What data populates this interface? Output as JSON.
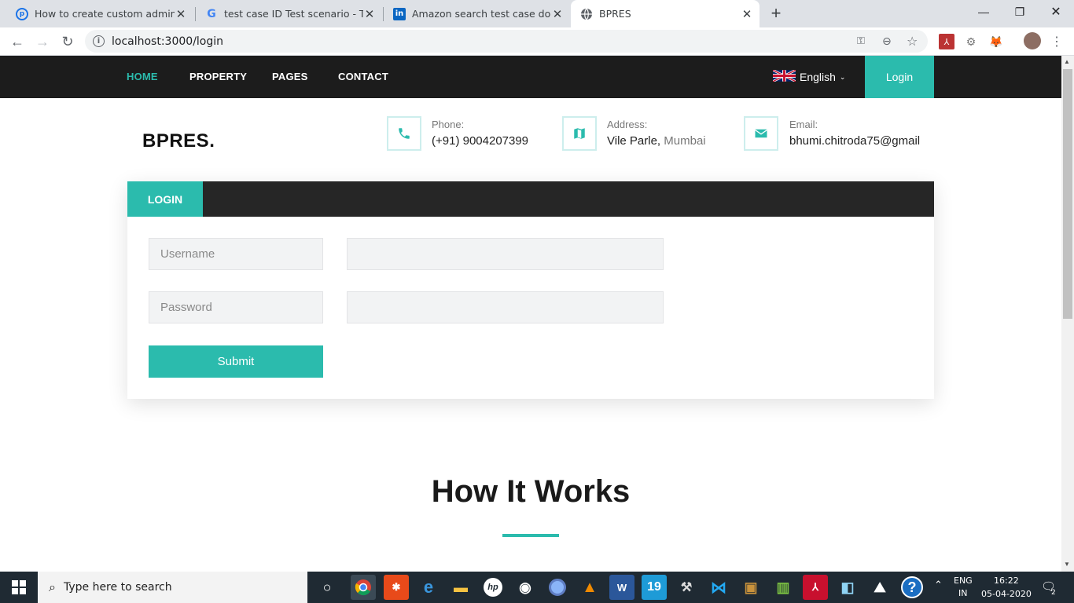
{
  "browser": {
    "tabs": [
      {
        "title": "How to create custom admin pag",
        "icon": "p-circle-icon"
      },
      {
        "title": "test case ID Test scenario - Test S",
        "icon": "google-icon"
      },
      {
        "title": "Amazon search test case docume",
        "icon": "linkedin-icon"
      },
      {
        "title": "BPRES",
        "icon": "globe-icon"
      }
    ],
    "url": "localhost:3000/login"
  },
  "site": {
    "nav": [
      "HOME",
      "PROPERTY",
      "PAGES",
      "CONTACT"
    ],
    "language": "English",
    "login_button": "Login",
    "brand": "BPRES.",
    "phone_label": "Phone:",
    "phone_value": "(+91) 9004207399",
    "address_label": "Address:",
    "address_value_main": "Vile Parle,",
    "address_value_city": "Mumbai",
    "email_label": "Email:",
    "email_value": "bhumi.chitroda75@gmail",
    "panel_tab": "LOGIN",
    "username_label": "Username",
    "password_label": "Password",
    "submit_label": "Submit",
    "section_title": "How It Works",
    "accent_color": "#2bbbad"
  },
  "taskbar": {
    "search_placeholder": "Type here to search",
    "lang_top": "ENG",
    "lang_bottom": "IN",
    "time": "16:22",
    "date": "05-04-2020",
    "notifications": "2"
  }
}
